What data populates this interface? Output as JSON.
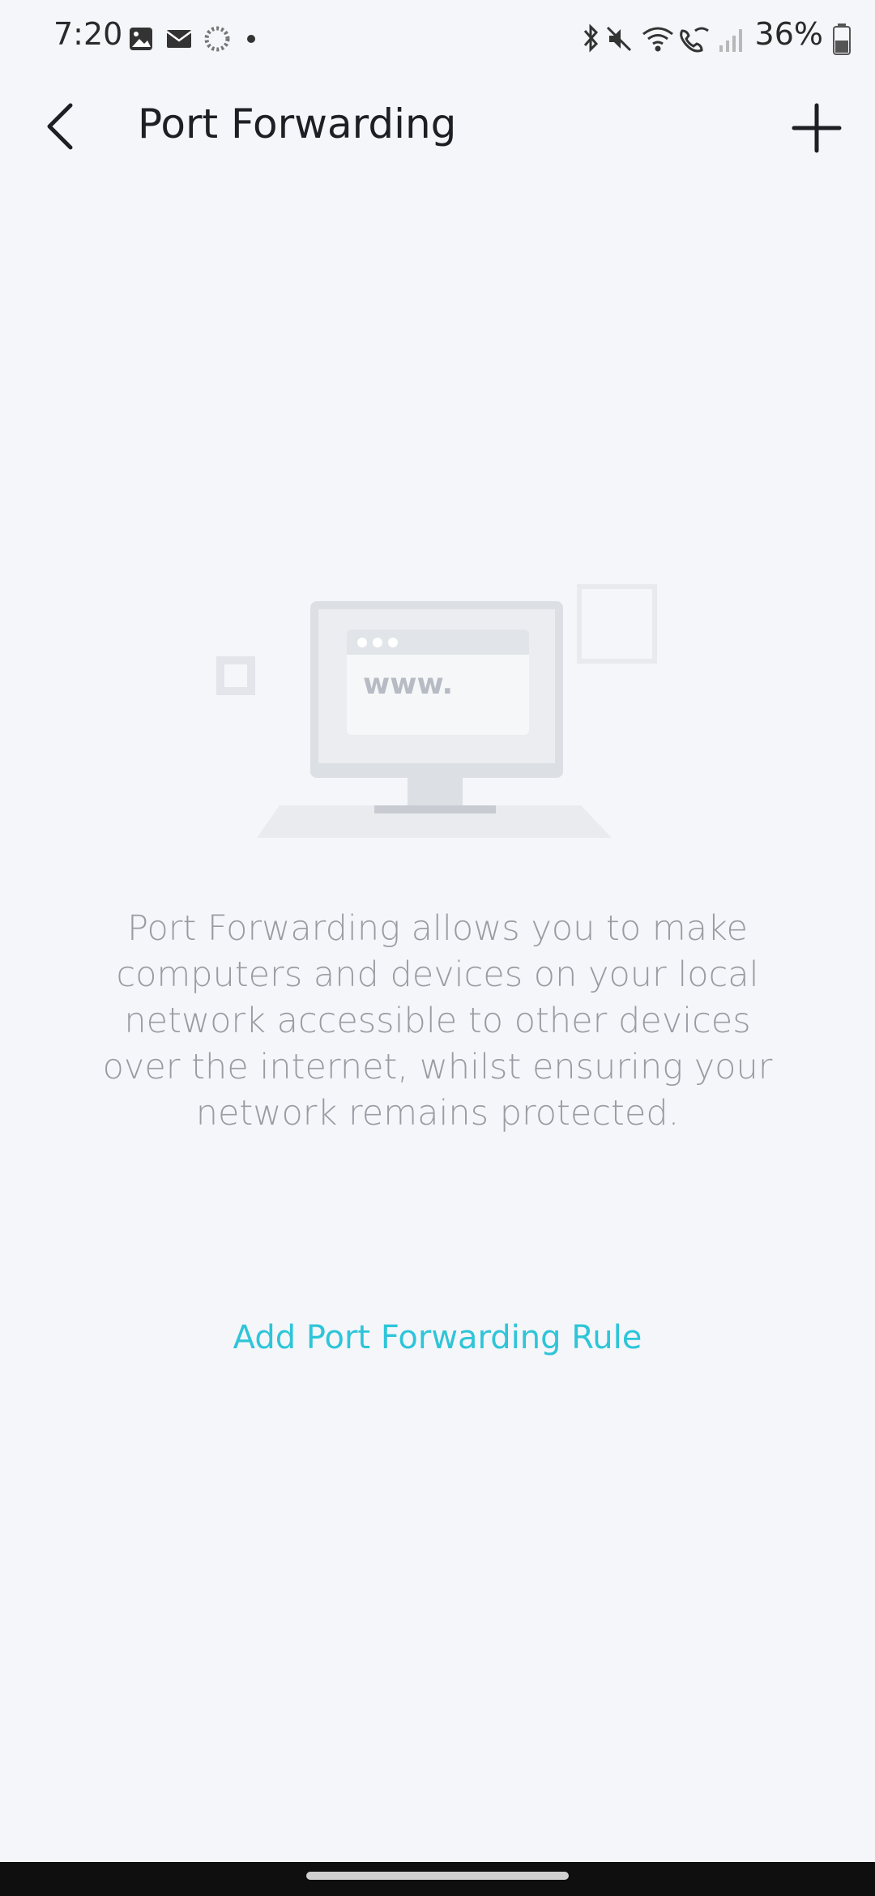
{
  "status_bar": {
    "time": "7:20",
    "battery_percent": "36%",
    "left_icons": [
      "gallery-icon",
      "mail-icon",
      "sync-icon",
      "dot-icon"
    ],
    "right_icons": [
      "bluetooth-icon",
      "mute-icon",
      "wifi-icon",
      "wifi-call-icon",
      "signal-icon",
      "battery-icon"
    ]
  },
  "header": {
    "title": "Port Forwarding",
    "back_icon": "chevron-left-icon",
    "add_icon": "plus-icon"
  },
  "empty_state": {
    "illustration_text": "www.",
    "description": "Port Forwarding allows you to make computers and devices on your local network accessible to other devices over the internet, whilst ensuring your network remains protected.",
    "action_label": "Add Port Forwarding Rule"
  },
  "colors": {
    "background": "#f5f6fa",
    "accent": "#2ec5d8",
    "title": "#1e1f24",
    "description": "#9a9ca3"
  }
}
